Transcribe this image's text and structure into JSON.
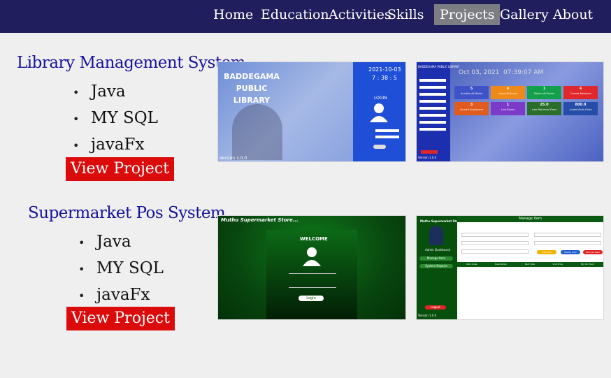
{
  "nav": {
    "items": [
      "Home",
      "Education",
      "Activities",
      "Skills",
      "Projects",
      "Gallery",
      "About"
    ],
    "active": "Projects"
  },
  "projects": [
    {
      "title": "Library Management System",
      "tech": [
        "Java",
        "MY SQL",
        "javaFx"
      ],
      "button": "View Project",
      "screens": {
        "login": {
          "brand_lines": [
            "BADDEGAMA",
            "PUBLIC",
            "LIBRARY"
          ],
          "date": "2021-10-03",
          "time": "7 : 38 : 5",
          "login_label": "LOGIN",
          "version": "Version 1.0.0"
        },
        "dashboard": {
          "header": "BADDEGAMA PUBLIC LIBRARY",
          "date": "Oct 03, 2021",
          "time": "07:39:07 AM",
          "tiles": [
            {
              "value": "5",
              "label": "Availble All Books",
              "color": "#3f52c8"
            },
            {
              "value": "4",
              "label": "Issue All Books",
              "color": "#ef8a18"
            },
            {
              "value": "1",
              "label": "Return All Books",
              "color": "#12a04a"
            },
            {
              "value": "4",
              "label": "Current Members",
              "color": "#e0272b"
            },
            {
              "value": "3",
              "label": "Current Employees",
              "color": "#e15b1e"
            },
            {
              "value": "1",
              "label": "Lost Books",
              "color": "#7c3ac9"
            },
            {
              "value": "25.0",
              "label": "Late Returned Fines",
              "color": "#2a6e2a"
            },
            {
              "value": "800.0",
              "label": "Losted Book Fines",
              "color": "#264ea8"
            }
          ],
          "version": "Version 1.0.0"
        }
      }
    },
    {
      "title": "Supermarket Pos System",
      "tech": [
        "Java",
        "MY SQL",
        "javaFx"
      ],
      "button": "View Project",
      "screens": {
        "login": {
          "store": "Muthu Supermarket Store...",
          "welcome": "WELCOME",
          "login_btn": "Login"
        },
        "manage": {
          "store": "Muthu Supermarket Store",
          "header": "Manage Item",
          "dashboard_label": "Admin Dashboard",
          "menu": [
            "Manage Item",
            "System Reports"
          ],
          "actions": [
            "Add Item",
            "Modify Item",
            "Remove Item"
          ],
          "columns": [
            "Item Code",
            "Description",
            "Pack Size",
            "Unit Price",
            "Qty On Hand"
          ],
          "logout": "Logout",
          "version": "Version 1.0.0"
        }
      }
    }
  ]
}
